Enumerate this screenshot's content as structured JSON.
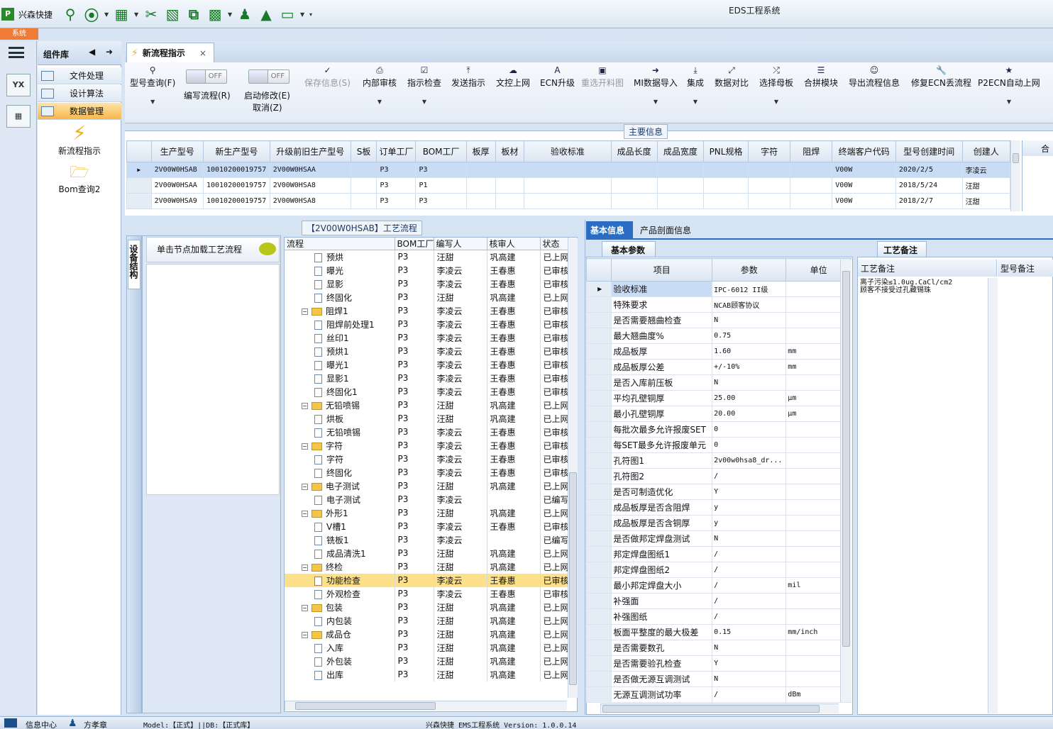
{
  "app": {
    "short_name": "兴森快捷",
    "window_title": "EDS工程系统",
    "system_tab": "系统"
  },
  "quick_icons": [
    "search-icon",
    "lifebuoy-icon",
    "grid-icon",
    "scissors-icon",
    "film-icon",
    "copy-icon",
    "apps-icon",
    "user-icon",
    "chart-icon",
    "monitor-icon"
  ],
  "component_library": {
    "title": "组件库",
    "categories": [
      "文件处理",
      "设计算法",
      "数据管理"
    ],
    "tools": [
      "新流程指示",
      "Bom查询2"
    ]
  },
  "doc_tab": {
    "label": "新流程指示",
    "close": "×"
  },
  "ribbon": {
    "model_query": "型号查询(F)",
    "edit_flow": "编写流程(R)",
    "start_modify": "启动修改(E)",
    "cancel": "取消(Z)",
    "toggle_off": "OFF",
    "buttons": [
      "保存信息(S)",
      "内部审核",
      "指示检查",
      "发送指示",
      "文控上网",
      "ECN升级",
      "重选开料图",
      "MI数据导入",
      "集成",
      "数据对比",
      "选择母板",
      "合拼模块",
      "导出流程信息",
      "修复ECN丢流程",
      "P2ECN自动上网"
    ]
  },
  "main_info": {
    "title": "主要信息",
    "columns": [
      "生产型号",
      "新生产型号",
      "升级前旧生产型号",
      "S板",
      "订单工厂",
      "BOM工厂",
      "板厚",
      "板材",
      "验收标准",
      "成品长度",
      "成品宽度",
      "PNL规格",
      "字符",
      "阻焊",
      "终端客户代码",
      "型号创建时间",
      "创建人",
      "合"
    ],
    "rows": [
      [
        "2V00W0HSAB",
        "10010200019757",
        "2V00W0HSAA",
        "",
        "P3",
        "P3",
        "",
        "",
        "",
        "",
        "",
        "",
        "",
        "",
        "V00W",
        "2020/2/5",
        "李凌云"
      ],
      [
        "2V00W0HSAA",
        "10010200019757",
        "2V00W0HSA8",
        "",
        "P3",
        "P1",
        "",
        "",
        "",
        "",
        "",
        "",
        "",
        "",
        "V00W",
        "2018/5/24",
        "汪甜"
      ],
      [
        "2V00W0HSA9",
        "10010200019757",
        "2V00W0HSA8",
        "",
        "P3",
        "P3",
        "",
        "",
        "",
        "",
        "",
        "",
        "",
        "",
        "V00W",
        "2018/2/7",
        "汪甜"
      ]
    ]
  },
  "flow": {
    "title": "【2V00W0HSAB】工艺流程",
    "side_label": "设备结构",
    "hint": "单击节点加载工艺流程",
    "columns": [
      "流程",
      "BOM工厂",
      "编写人",
      "核审人",
      "状态"
    ],
    "rows": [
      {
        "name": "预烘",
        "lvl": 2,
        "f": "P3",
        "w": "汪甜",
        "r": "巩高建",
        "s": "已上网"
      },
      {
        "name": "曝光",
        "lvl": 2,
        "f": "P3",
        "w": "李凌云",
        "r": "王春惠",
        "s": "已审核"
      },
      {
        "name": "显影",
        "lvl": 2,
        "f": "P3",
        "w": "李凌云",
        "r": "王春惠",
        "s": "已审核"
      },
      {
        "name": "终固化",
        "lvl": 2,
        "f": "P3",
        "w": "汪甜",
        "r": "巩高建",
        "s": "已上网"
      },
      {
        "name": "阻焊1",
        "lvl": 1,
        "f": "P3",
        "w": "李凌云",
        "r": "王春惠",
        "s": "已审核"
      },
      {
        "name": "阻焊前处理1",
        "lvl": 2,
        "f": "P3",
        "w": "李凌云",
        "r": "王春惠",
        "s": "已审核"
      },
      {
        "name": "丝印1",
        "lvl": 2,
        "f": "P3",
        "w": "李凌云",
        "r": "王春惠",
        "s": "已审核"
      },
      {
        "name": "预烘1",
        "lvl": 2,
        "f": "P3",
        "w": "李凌云",
        "r": "王春惠",
        "s": "已审核"
      },
      {
        "name": "曝光1",
        "lvl": 2,
        "f": "P3",
        "w": "李凌云",
        "r": "王春惠",
        "s": "已审核"
      },
      {
        "name": "显影1",
        "lvl": 2,
        "f": "P3",
        "w": "李凌云",
        "r": "王春惠",
        "s": "已审核"
      },
      {
        "name": "终固化1",
        "lvl": 2,
        "f": "P3",
        "w": "李凌云",
        "r": "王春惠",
        "s": "已审核"
      },
      {
        "name": "无铅喷锡",
        "lvl": 1,
        "f": "P3",
        "w": "汪甜",
        "r": "巩高建",
        "s": "已上网"
      },
      {
        "name": "烘板",
        "lvl": 2,
        "f": "P3",
        "w": "汪甜",
        "r": "巩高建",
        "s": "已上网"
      },
      {
        "name": "无铅喷锡",
        "lvl": 2,
        "f": "P3",
        "w": "李凌云",
        "r": "王春惠",
        "s": "已审核"
      },
      {
        "name": "字符",
        "lvl": 1,
        "f": "P3",
        "w": "李凌云",
        "r": "王春惠",
        "s": "已审核"
      },
      {
        "name": "字符",
        "lvl": 2,
        "f": "P3",
        "w": "李凌云",
        "r": "王春惠",
        "s": "已审核"
      },
      {
        "name": "终固化",
        "lvl": 2,
        "f": "P3",
        "w": "李凌云",
        "r": "王春惠",
        "s": "已审核"
      },
      {
        "name": "电子测试",
        "lvl": 1,
        "f": "P3",
        "w": "汪甜",
        "r": "巩高建",
        "s": "已上网"
      },
      {
        "name": "电子测试",
        "lvl": 2,
        "f": "P3",
        "w": "李凌云",
        "r": "",
        "s": "已编写"
      },
      {
        "name": "外形1",
        "lvl": 1,
        "f": "P3",
        "w": "汪甜",
        "r": "巩高建",
        "s": "已上网"
      },
      {
        "name": "V槽1",
        "lvl": 2,
        "f": "P3",
        "w": "李凌云",
        "r": "王春惠",
        "s": "已审核"
      },
      {
        "name": "铣板1",
        "lvl": 2,
        "f": "P3",
        "w": "李凌云",
        "r": "",
        "s": "已编写"
      },
      {
        "name": "成品清洗1",
        "lvl": 2,
        "f": "P3",
        "w": "汪甜",
        "r": "巩高建",
        "s": "已上网"
      },
      {
        "name": "终检",
        "lvl": 1,
        "f": "P3",
        "w": "汪甜",
        "r": "巩高建",
        "s": "已上网"
      },
      {
        "name": "功能检查",
        "lvl": 2,
        "f": "P3",
        "w": "李凌云",
        "r": "王春惠",
        "s": "已审核",
        "hi": true
      },
      {
        "name": "外观检查",
        "lvl": 2,
        "f": "P3",
        "w": "李凌云",
        "r": "王春惠",
        "s": "已审核"
      },
      {
        "name": "包装",
        "lvl": 1,
        "f": "P3",
        "w": "汪甜",
        "r": "巩高建",
        "s": "已上网"
      },
      {
        "name": "内包装",
        "lvl": 2,
        "f": "P3",
        "w": "汪甜",
        "r": "巩高建",
        "s": "已上网"
      },
      {
        "name": "成品仓",
        "lvl": 1,
        "f": "P3",
        "w": "汪甜",
        "r": "巩高建",
        "s": "已上网"
      },
      {
        "name": "入库",
        "lvl": 2,
        "f": "P3",
        "w": "汪甜",
        "r": "巩高建",
        "s": "已上网"
      },
      {
        "name": "外包装",
        "lvl": 2,
        "f": "P3",
        "w": "汪甜",
        "r": "巩高建",
        "s": "已上网"
      },
      {
        "name": "出库",
        "lvl": 2,
        "f": "P3",
        "w": "汪甜",
        "r": "巩高建",
        "s": "已上网"
      }
    ]
  },
  "detail": {
    "tabs": [
      "基本信息",
      "产品剖面信息"
    ],
    "basic_tab": "基本参数",
    "columns": [
      "项目",
      "参数",
      "单位"
    ],
    "rows": [
      [
        "验收标准",
        "IPC-6012 II级",
        ""
      ],
      [
        "特殊要求",
        "NCAB顾客协议",
        ""
      ],
      [
        "是否需要翘曲检查",
        "N",
        ""
      ],
      [
        "最大翘曲度%",
        "0.75",
        ""
      ],
      [
        "成品板厚",
        "1.60",
        "mm"
      ],
      [
        "成品板厚公差",
        "+/-10%",
        "mm"
      ],
      [
        "是否入库前压板",
        "N",
        ""
      ],
      [
        "平均孔壁铜厚",
        "25.00",
        "μm"
      ],
      [
        "最小孔壁铜厚",
        "20.00",
        "μm"
      ],
      [
        "每批次最多允许报废SET",
        "0",
        ""
      ],
      [
        "每SET最多允许报废单元",
        "0",
        ""
      ],
      [
        "孔符图1",
        "2v00w0hsa8_dr...",
        ""
      ],
      [
        "孔符图2",
        "/",
        ""
      ],
      [
        "是否可制造优化",
        "Y",
        ""
      ],
      [
        "成品板厚是否含阻焊",
        "y",
        ""
      ],
      [
        "成品板厚是否含铜厚",
        "y",
        ""
      ],
      [
        "是否做邦定焊盘测试",
        "N",
        ""
      ],
      [
        "邦定焊盘图纸1",
        "/",
        ""
      ],
      [
        "邦定焊盘图纸2",
        "/",
        ""
      ],
      [
        "最小邦定焊盘大小",
        "/",
        "mil"
      ],
      [
        "补强面",
        "/",
        ""
      ],
      [
        "补强图纸",
        "/",
        ""
      ],
      [
        "板面平整度的最大极差",
        "0.15",
        "mm/inch"
      ],
      [
        "是否需要数孔",
        "N",
        ""
      ],
      [
        "是否需要验孔检查",
        "Y",
        ""
      ],
      [
        "是否做无源互调测试",
        "N",
        ""
      ],
      [
        "无源互调测试功率",
        "/",
        "dBm"
      ]
    ]
  },
  "notes": {
    "title": "工艺备注",
    "col1": "工艺备注",
    "col2": "型号备注",
    "text1": "离子污染≤1.0ug.CaCl/cm2",
    "text2": "顾客不接受过孔藏锡珠"
  },
  "statusbar": {
    "info_center": "信息中心",
    "user": "方孝章",
    "model_db": "Model:【正式】||DB:【正式库】",
    "version": "兴森快捷 EMS工程系统 Version: 1.0.0.14"
  }
}
